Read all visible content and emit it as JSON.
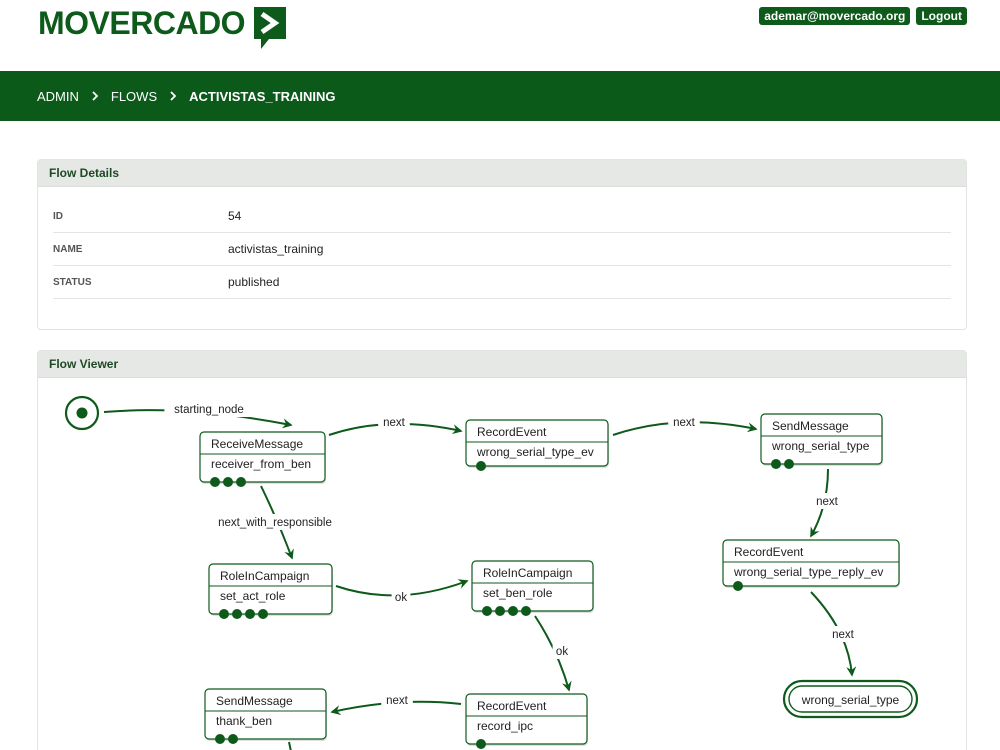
{
  "brand": {
    "name": "MOVERCADO",
    "color": "#0d5a1b"
  },
  "user": {
    "email": "ademar@movercado.org",
    "logout_label": "Logout"
  },
  "breadcrumb": [
    {
      "label": "ADMIN"
    },
    {
      "label": "FLOWS"
    },
    {
      "label": "ACTIVISTAS_TRAINING"
    }
  ],
  "flow_details": {
    "title": "Flow Details",
    "rows": [
      {
        "key": "ID",
        "value": "54"
      },
      {
        "key": "NAME",
        "value": "activistas_training"
      },
      {
        "key": "STATUS",
        "value": "published"
      }
    ]
  },
  "flow_viewer": {
    "title": "Flow Viewer",
    "nodes": [
      {
        "id": "rm",
        "type": "ReceiveMessage",
        "name": "receiver_from_ben",
        "dots": 3
      },
      {
        "id": "re1",
        "type": "RecordEvent",
        "name": "wrong_serial_type_ev",
        "dots": 1
      },
      {
        "id": "sm1",
        "type": "SendMessage",
        "name": "wrong_serial_type",
        "dots": 2
      },
      {
        "id": "re2",
        "type": "RecordEvent",
        "name": "wrong_serial_type_reply_ev",
        "dots": 1
      },
      {
        "id": "ric1",
        "type": "RoleInCampaign",
        "name": "set_act_role",
        "dots": 4
      },
      {
        "id": "ric2",
        "type": "RoleInCampaign",
        "name": "set_ben_role",
        "dots": 4
      },
      {
        "id": "re3",
        "type": "RecordEvent",
        "name": "record_ipc",
        "dots": 1
      },
      {
        "id": "sm2",
        "type": "SendMessage",
        "name": "thank_ben",
        "dots": 2
      }
    ],
    "terminal": {
      "id": "end",
      "label": "wrong_serial_type"
    },
    "edges": [
      {
        "from": "start",
        "to": "rm",
        "label": "starting_node"
      },
      {
        "from": "rm",
        "to": "re1",
        "label": "next"
      },
      {
        "from": "re1",
        "to": "sm1",
        "label": "next"
      },
      {
        "from": "sm1",
        "to": "re2",
        "label": "next"
      },
      {
        "from": "re2",
        "to": "end",
        "label": "next"
      },
      {
        "from": "rm",
        "to": "ric1",
        "label": "next_with_responsible"
      },
      {
        "from": "ric1",
        "to": "ric2",
        "label": "ok"
      },
      {
        "from": "ric2",
        "to": "re3",
        "label": "ok"
      },
      {
        "from": "re3",
        "to": "sm2",
        "label": "next"
      },
      {
        "from": "sm2",
        "to": "below",
        "label": ""
      }
    ]
  }
}
